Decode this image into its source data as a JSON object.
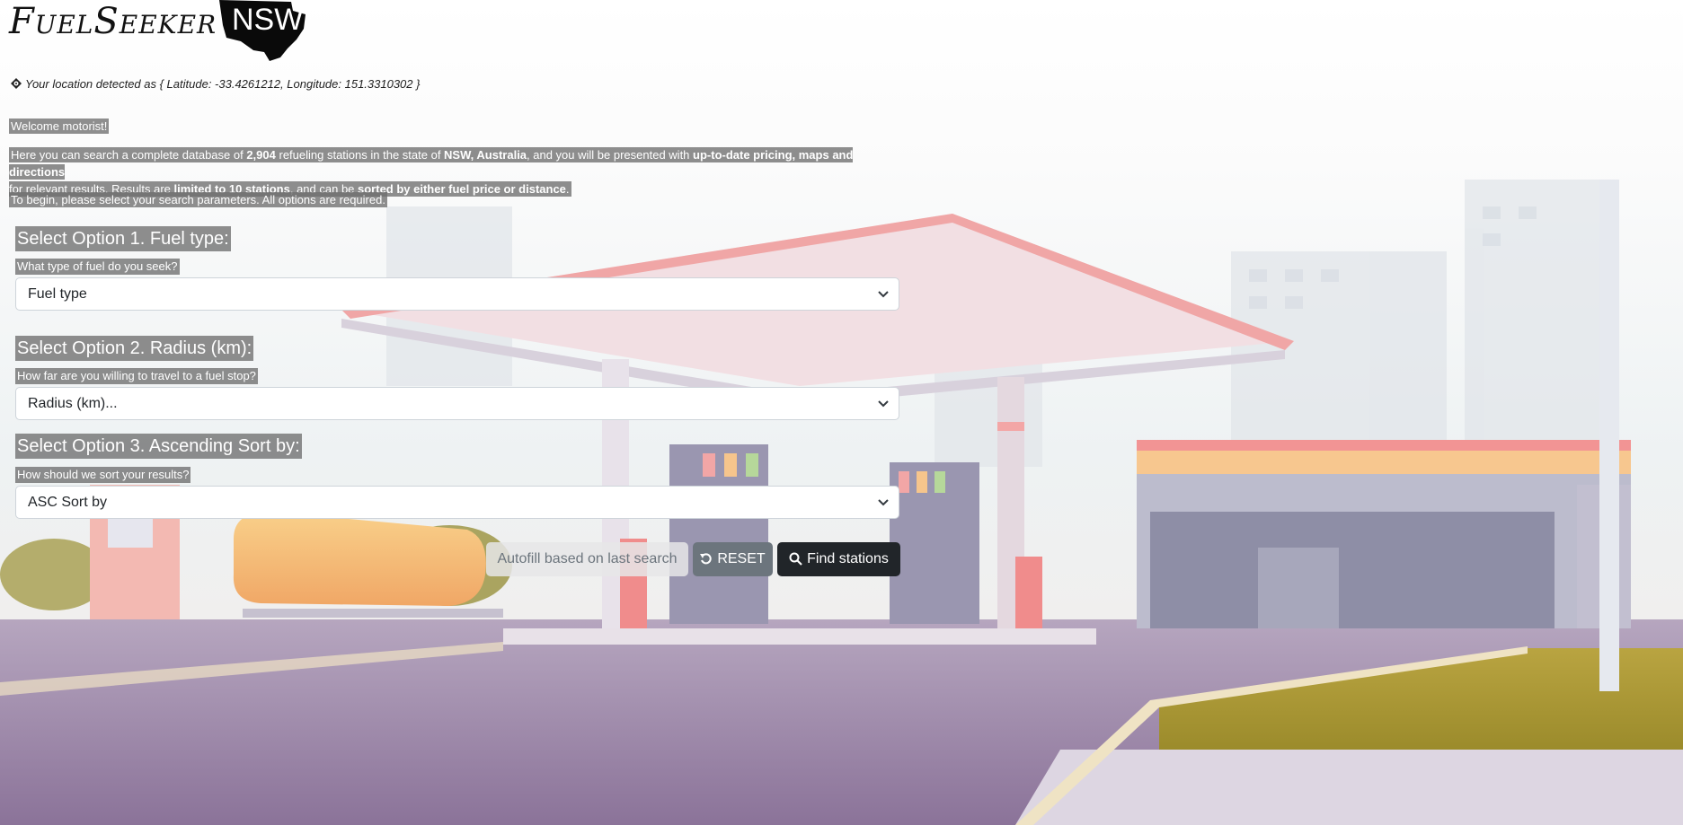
{
  "logo": {
    "name": "FuelSeeker",
    "region": "NSW"
  },
  "location": {
    "text": "Your location detected as { Latitude: -33.4261212, Longitude: 151.3310302 }",
    "icon": "crosshair-icon"
  },
  "intro": {
    "welcome": "Welcome motorist!",
    "p1": "Here you can search a complete database of ",
    "count": "2,904",
    "p2": " refueling stations in the state of ",
    "state": "NSW, Australia",
    "p3": ", and you will be presented with ",
    "features": "up-to-date pricing, maps and directions",
    "p4": " for relevant results. Results are ",
    "limit": "limited to 10 stations",
    "p5": ", and can be ",
    "sort": "sorted by either fuel price or distance",
    "p6": ".",
    "begin": "To begin, please select your search parameters. All options are required."
  },
  "options": {
    "fuel": {
      "title": "Select Option 1. Fuel type:",
      "question": "What type of fuel do you seek?",
      "value": "Fuel type"
    },
    "radius": {
      "title": "Select Option 2. Radius (km):",
      "question": "How far are you willing to travel to a fuel stop?",
      "value": "Radius (km)..."
    },
    "sort": {
      "title": "Select Option 3. Ascending Sort by:",
      "question": "How should we sort your results?",
      "value": "ASC Sort by"
    }
  },
  "buttons": {
    "autofill": "Autofill based on last search",
    "reset": "RESET",
    "find": "Find stations",
    "reset_icon": "undo-icon",
    "find_icon": "search-icon"
  },
  "colors": {
    "highlight": "#6e6e6e",
    "reset_btn": "#6c757d",
    "find_btn": "#212529"
  }
}
